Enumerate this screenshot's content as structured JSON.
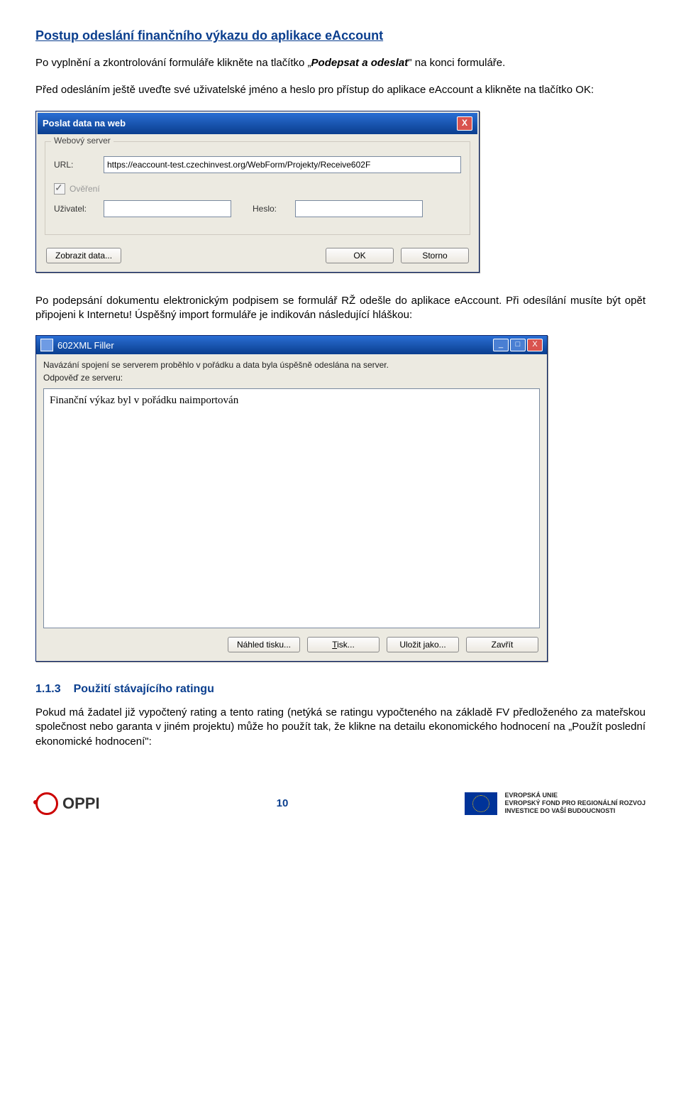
{
  "heading": "Postup odeslání finančního výkazu do aplikace eAccount",
  "para1_a": "Po vyplnění a zkontrolování formuláře klikněte na tlačítko „",
  "para1_em": "Podepsat a odeslat",
  "para1_b": "\" na konci formuláře.",
  "para2": "Před odesláním ještě uveďte své uživatelské jméno a heslo pro přístup do aplikace eAccount a klikněte na tlačítko OK:",
  "dlg1": {
    "title": "Poslat data na web",
    "group": "Webový server",
    "url_label": "URL:",
    "url_value": "https://eaccount-test.czechinvest.org/WebForm/Projekty/Receive602F",
    "overeni": "Ověření",
    "user_label": "Uživatel:",
    "pass_label": "Heslo:",
    "btn_show": "Zobrazit data...",
    "btn_ok": "OK",
    "btn_cancel": "Storno"
  },
  "para3": "Po podepsání dokumentu elektronickým podpisem se formulář RŽ odešle do aplikace eAccount. Při odesílání musíte být opět připojeni k Internetu! Úspěšný import formuláře je indikován následující hláškou:",
  "dlg2": {
    "title": "602XML Filler",
    "status": "Navázání spojení se serverem proběhlo v pořádku a data byla úspěšně odeslána na server.",
    "server_label": "Odpověď ze serveru:",
    "body": "Finanční výkaz byl v pořádku naimportován",
    "btn_preview": "Náhled tisku...",
    "btn_print": "Tisk...",
    "btn_saveas": "Uložit jako...",
    "btn_close": "Zavřít"
  },
  "section": {
    "num": "1.1.3",
    "title": "Použití stávajícího ratingu"
  },
  "para4": "Pokud má žadatel již vypočtený rating a tento rating (netýká se ratingu vypočteného na základě FV předloženého za mateřskou společnost nebo garanta v jiném projektu) může ho použít tak, že klikne na detailu ekonomického hodnocení na „Použít poslední ekonomické hodnocení\":",
  "footer": {
    "oppi": "OPPI",
    "page": "10",
    "eu1": "EVROPSKÁ UNIE",
    "eu2": "EVROPSKÝ FOND PRO REGIONÁLNÍ ROZVOJ",
    "eu3": "INVESTICE DO VAŠÍ BUDOUCNOSTI"
  }
}
